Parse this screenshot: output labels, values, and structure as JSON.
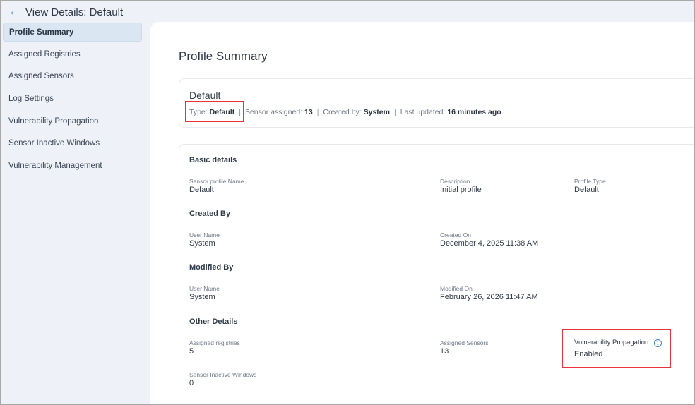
{
  "header": {
    "title": "View Details: Default"
  },
  "sidebar": {
    "items": [
      {
        "label": "Profile Summary"
      },
      {
        "label": "Assigned Registries"
      },
      {
        "label": "Assigned Sensors"
      },
      {
        "label": "Log Settings"
      },
      {
        "label": "Vulnerability Propagation"
      },
      {
        "label": "Sensor Inactive Windows"
      },
      {
        "label": "Vulnerability Management"
      }
    ]
  },
  "main": {
    "title": "Profile Summary",
    "summary": {
      "name": "Default",
      "type_label": "Type:",
      "type_value": "Default",
      "sensor_label": "Sensor assigned:",
      "sensor_value": "13",
      "created_label": "Created by:",
      "created_value": "System",
      "updated_label": "Last updated:",
      "updated_value": "16 minutes ago",
      "separator": "|"
    },
    "basic": {
      "title": "Basic details",
      "name_label": "Sensor profile Name",
      "name_value": "Default",
      "desc_label": "Description",
      "desc_value": "Initial profile",
      "ptype_label": "Profile Type",
      "ptype_value": "Default"
    },
    "created": {
      "title": "Created By",
      "user_label": "User Name",
      "user_value": "System",
      "on_label": "Created On",
      "on_value": "December 4, 2025 11:38 AM"
    },
    "modified": {
      "title": "Modified By",
      "user_label": "User Name",
      "user_value": "System",
      "on_label": "Modified On",
      "on_value": "February 26, 2026 11:47 AM"
    },
    "other": {
      "title": "Other Details",
      "reg_label": "Assigned registries",
      "reg_value": "5",
      "sens_label": "Assigned Sensors",
      "sens_value": "13",
      "vp_label": "Vulnerability Propagation",
      "vp_value": "Enabled",
      "siw_label": "Sensor Inactive Windows",
      "siw_value": "0"
    }
  }
}
